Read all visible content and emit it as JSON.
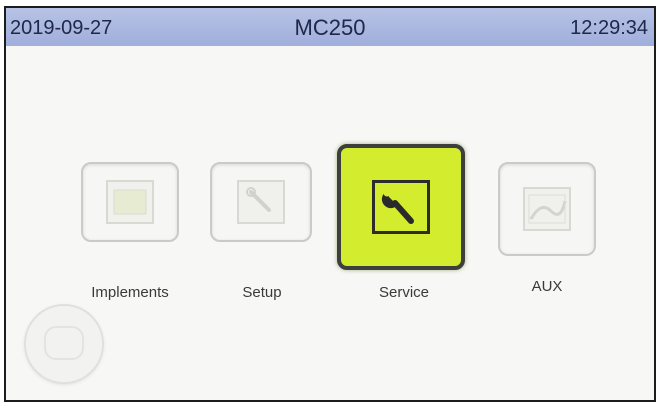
{
  "status_bar": {
    "date": "2019-09-27",
    "model": "MC250",
    "time": "12:29:34"
  },
  "menu": {
    "items": [
      {
        "label": "Implements",
        "icon": "implements-icon",
        "state": "inactive"
      },
      {
        "label": "Setup",
        "icon": "wrench-icon",
        "state": "inactive"
      },
      {
        "label": "Service",
        "icon": "wrench-icon",
        "state": "selected"
      },
      {
        "label": "AUX",
        "icon": "aux-icon",
        "state": "inactive"
      }
    ]
  },
  "colors": {
    "status_bar": "#a8b6e0",
    "selected_tile": "#d3ec2e",
    "selected_border": "#3c3f3c",
    "inactive_tile_border": "#cbcbc6"
  }
}
